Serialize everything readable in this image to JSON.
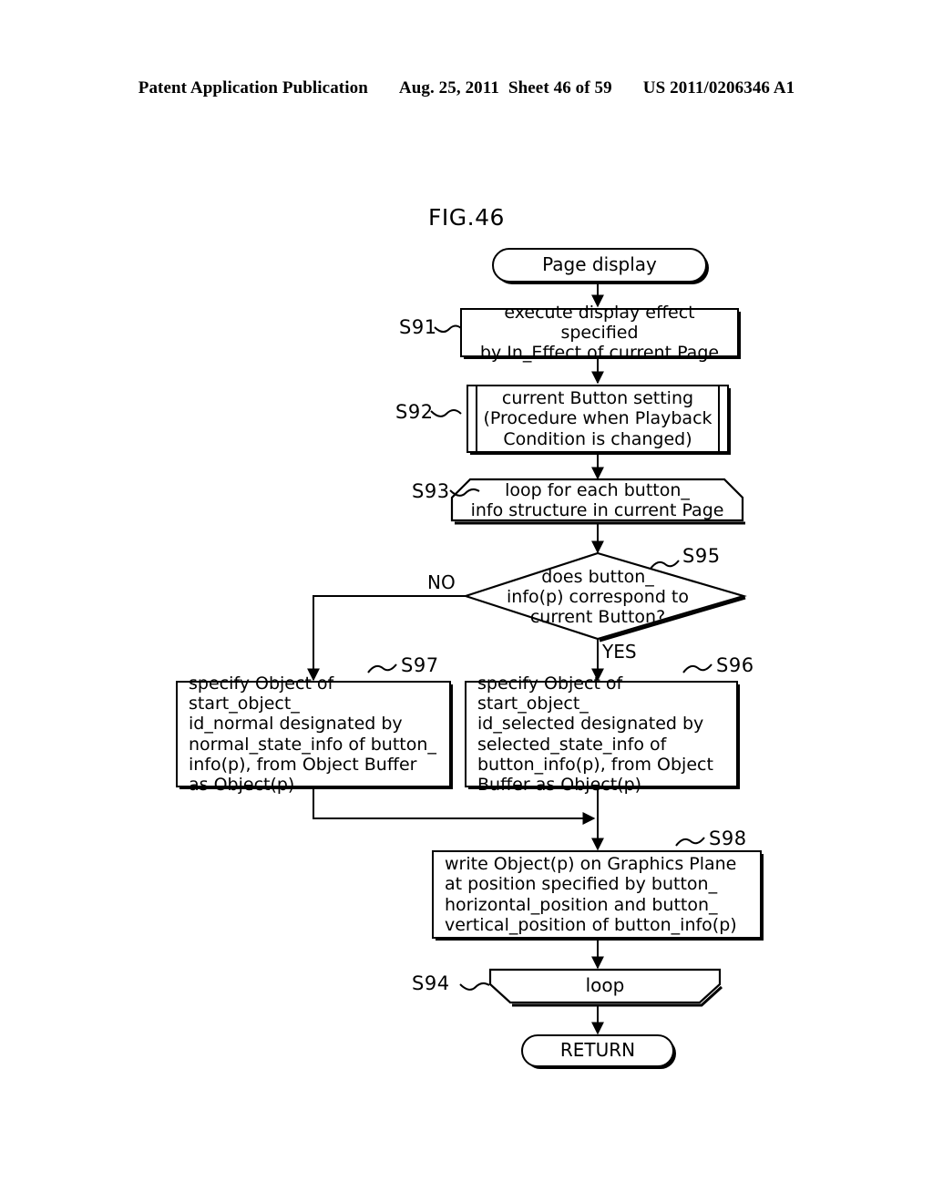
{
  "header": {
    "left": "Patent Application Publication",
    "date": "Aug. 25, 2011",
    "sheet": "Sheet 46 of 59",
    "pub_number": "US 2011/0206346 A1"
  },
  "figure": {
    "caption": "FIG.46"
  },
  "flow": {
    "start": {
      "id": "",
      "label": "Page display",
      "shape": "terminal"
    },
    "s91": {
      "id": "S91",
      "label": "execute display effect specified\nby In_Effect of current  Page",
      "shape": "process"
    },
    "s92": {
      "id": "S92",
      "label": "current Button setting\n(Procedure when Playback\nCondition is changed)",
      "shape": "predefined-process"
    },
    "s93": {
      "id": "S93",
      "label": "loop for each button_\ninfo structure in current Page",
      "shape": "loop-start"
    },
    "s95": {
      "id": "S95",
      "label": "does button_\ninfo(p) correspond to\ncurrent Button?",
      "shape": "decision",
      "branch_no": "NO",
      "branch_yes": "YES"
    },
    "s97": {
      "id": "S97",
      "label": "specify Object of start_object_\nid_normal designated by\nnormal_state_info of button_\ninfo(p), from Object Buffer\nas Object(p)",
      "shape": "process"
    },
    "s96": {
      "id": "S96",
      "label": "specify Object of start_object_\nid_selected designated by\nselected_state_info of\nbutton_info(p), from Object\nBuffer as Object(p)",
      "shape": "process"
    },
    "s98": {
      "id": "S98",
      "label": "write Object(p) on Graphics Plane\nat position specified by button_\nhorizontal_position and button_\nvertical_position of button_info(p)",
      "shape": "process"
    },
    "s94": {
      "id": "S94",
      "label": "loop",
      "shape": "loop-end"
    },
    "end": {
      "id": "",
      "label": "RETURN",
      "shape": "terminal"
    }
  },
  "colors": {
    "ink": "#000000",
    "paper": "#ffffff"
  }
}
